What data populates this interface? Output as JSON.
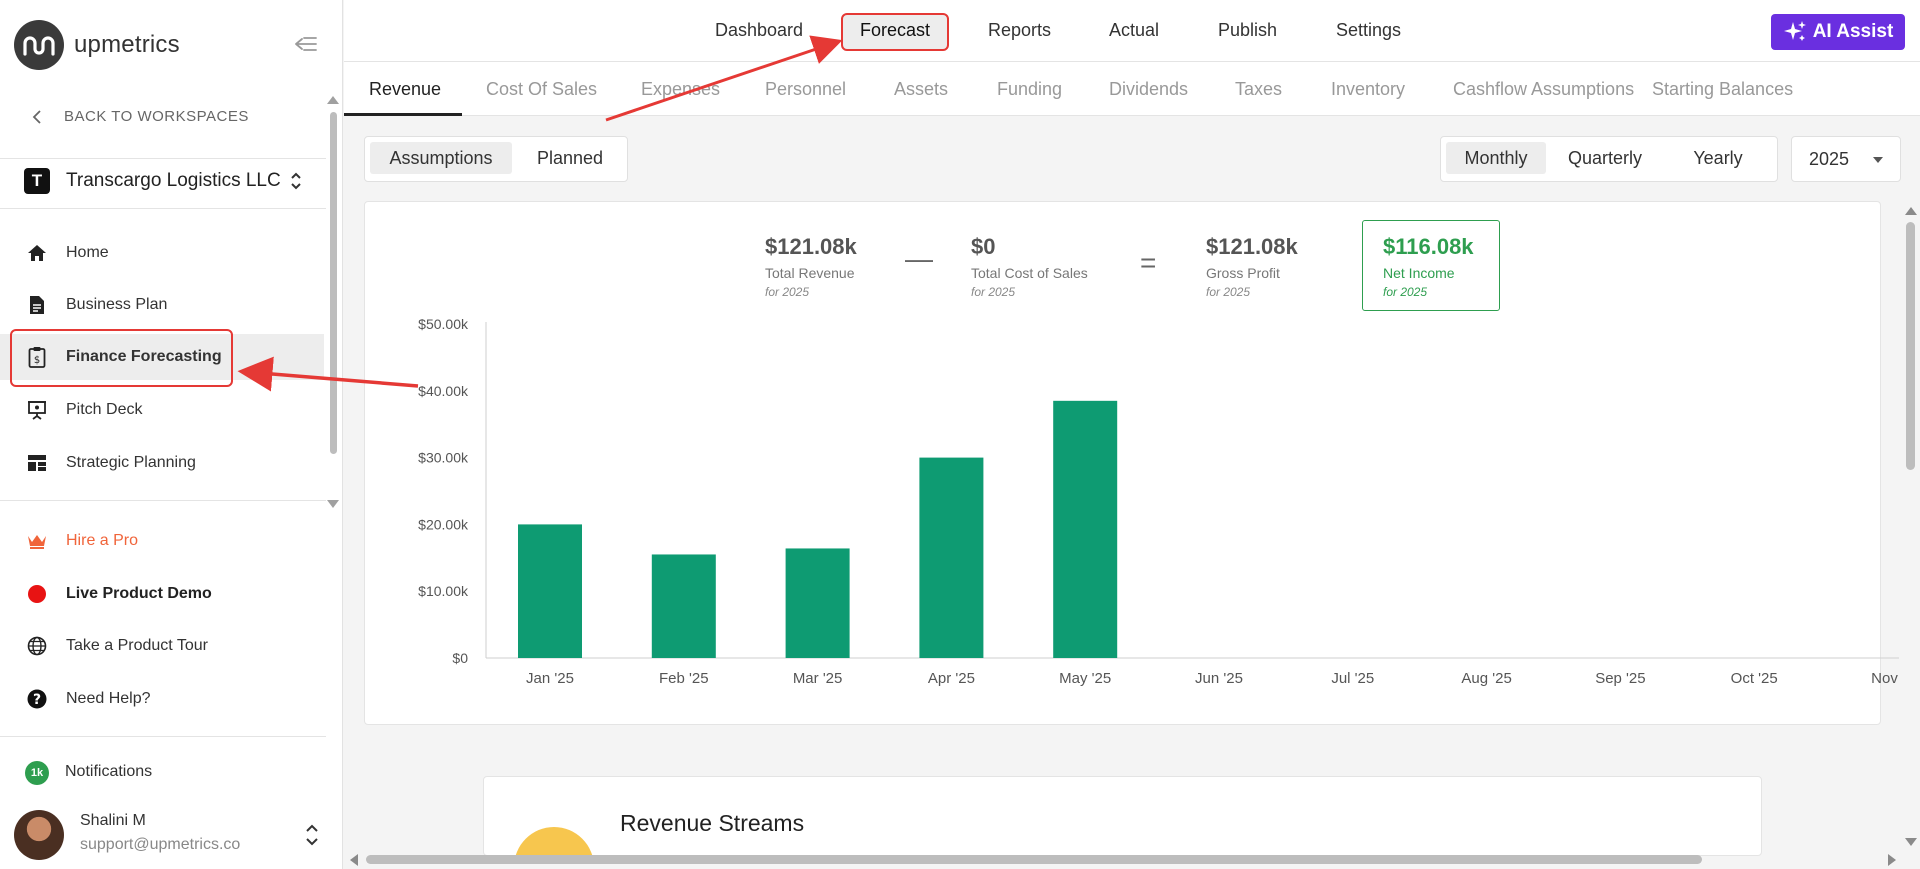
{
  "brand": {
    "name": "upmetrics"
  },
  "sidebar": {
    "back_label": "BACK TO WORKSPACES",
    "company": {
      "initial": "T",
      "name": "Transcargo Logistics LLC"
    },
    "items": [
      {
        "label": "Home",
        "icon": "home-icon"
      },
      {
        "label": "Business Plan",
        "icon": "document-icon"
      },
      {
        "label": "Finance Forecasting",
        "icon": "clipboard-dollar-icon"
      },
      {
        "label": "Pitch Deck",
        "icon": "presentation-icon"
      },
      {
        "label": "Strategic Planning",
        "icon": "dashboard-icon"
      }
    ],
    "extras": [
      {
        "label": "Hire a Pro",
        "icon": "crown-icon"
      },
      {
        "label": "Live Product Demo",
        "icon": "live-dot-icon"
      },
      {
        "label": "Take a Product Tour",
        "icon": "globe-icon"
      },
      {
        "label": "Need Help?",
        "icon": "help-icon"
      }
    ],
    "notifications": {
      "badge": "1k",
      "label": "Notifications"
    },
    "user": {
      "name": "Shalini M",
      "email": "support@upmetrics.co"
    }
  },
  "topnav": {
    "items": [
      "Dashboard",
      "Forecast",
      "Reports",
      "Actual",
      "Publish",
      "Settings"
    ],
    "ai_assist": "AI Assist"
  },
  "subtabs": [
    "Revenue",
    "Cost Of Sales",
    "Expenses",
    "Personnel",
    "Assets",
    "Funding",
    "Dividends",
    "Taxes",
    "Inventory",
    "Cashflow Assumptions",
    "Starting Balances"
  ],
  "mode_toggle": [
    "Assumptions",
    "Planned"
  ],
  "period_toggle": [
    "Monthly",
    "Quarterly",
    "Yearly"
  ],
  "year": "2025",
  "summary": {
    "revenue": {
      "value": "$121.08k",
      "label": "Total Revenue",
      "sub": "for 2025"
    },
    "minus": "—",
    "cost": {
      "value": "$0",
      "label": "Total Cost of Sales",
      "sub": "for 2025"
    },
    "equals": "=",
    "gross": {
      "value": "$121.08k",
      "label": "Gross Profit",
      "sub": "for 2025"
    },
    "net": {
      "value": "$116.08k",
      "label": "Net Income",
      "sub": "for 2025"
    }
  },
  "colors": {
    "bar": "#0e9b72",
    "net": "#2e9e4f",
    "accent": "#6a2fe0",
    "highlight": "#e53935",
    "hire": "#f0643a"
  },
  "chart_data": {
    "type": "bar",
    "categories": [
      "Jan '25",
      "Feb '25",
      "Mar '25",
      "Apr '25",
      "May '25",
      "Jun '25",
      "Jul '25",
      "Aug '25",
      "Sep '25",
      "Oct '25",
      "Nov '"
    ],
    "values": [
      20000,
      15500,
      16400,
      30000,
      38500,
      0,
      0,
      0,
      0,
      0,
      0
    ],
    "y_ticks": [
      "$0",
      "$10.00k",
      "$20.00k",
      "$30.00k",
      "$40.00k",
      "$50.00k"
    ],
    "ylim": [
      0,
      50000
    ],
    "grid": false
  },
  "streams": {
    "title": "Revenue Streams"
  }
}
